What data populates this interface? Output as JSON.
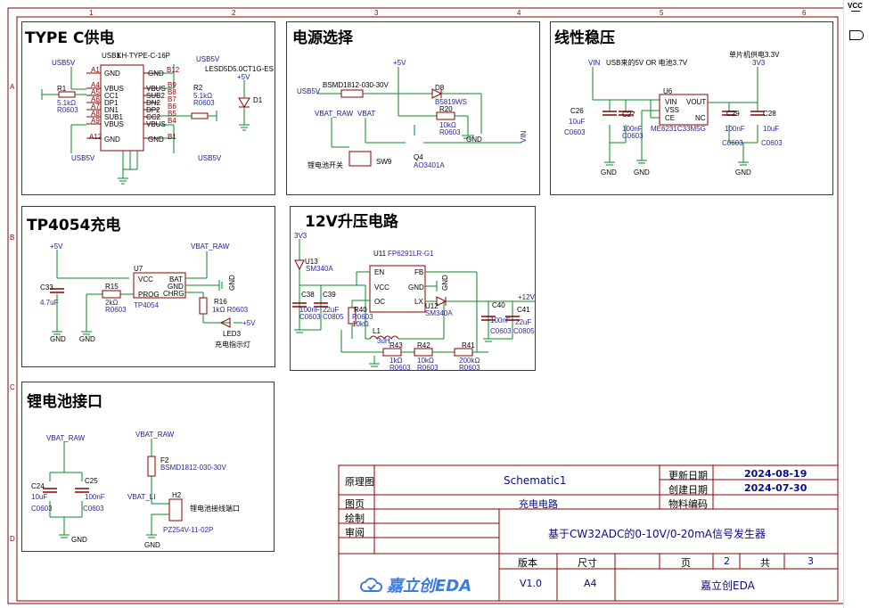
{
  "sections": {
    "typec": "TYPE C供电",
    "power_select": "电源选择",
    "ldo": "线性稳压",
    "charger": "TP4054充电",
    "boost": "12V升压电路",
    "battery": "锂电池接口"
  },
  "typec": {
    "usb_ref": "USB1",
    "usb_part": "KH-TYPE-C-16P",
    "net_usb5v_a": "USB5V",
    "net_usb5v_b": "USB5V",
    "net_usb5v_c": "USB5V",
    "net_usb5v_d": "USB5V",
    "pins_left": [
      "A1",
      "A4",
      "A5",
      "A6",
      "A7",
      "A8",
      "A9",
      "A12"
    ],
    "labels_left": [
      "GND",
      "VBUS",
      "CC1",
      "DP1",
      "DN1",
      "SUB1",
      "VBUS",
      "GND"
    ],
    "pins_right": [
      "B12",
      "B9",
      "B8",
      "B7",
      "B6",
      "B5",
      "B4",
      "B1"
    ],
    "labels_right": [
      "GND",
      "VBUS",
      "SUB2",
      "DN2",
      "DP2",
      "CC2",
      "VBUS",
      "GND"
    ],
    "r1_ref": "R1",
    "r1_val": "5.1kΩ",
    "r1_pkg": "R0603",
    "r2_ref": "R2",
    "r2_val": "5.1kΩ",
    "r2_pkg": "R0603",
    "d1_ref": "D1",
    "d1_part": "LESD5D5.0CT1G-ES",
    "net_5v": "+5V"
  },
  "power_select": {
    "net_5v": "+5V",
    "f_part": "BSMD1812-030-30V",
    "net_usb5v": "USB5V",
    "d8_ref": "D8",
    "d8_part": "B5819WS",
    "r20_ref": "R20",
    "r20_val": "10kΩ",
    "r20_pkg": "R0603",
    "net_vbat_raw": "VBAT_RAW",
    "net_vbat": "VBAT",
    "gnd": "GND",
    "q4_ref": "Q4",
    "q4_part": "AO3401A",
    "sw_ref": "SW9",
    "sw_label": "锂电池开关",
    "net_vin": "VIN"
  },
  "ldo": {
    "net_vin": "VIN",
    "note_in": "USB来的5V OR 电池3.7V",
    "note_out": "单片机供电3.3V",
    "net_3v3": "3V3",
    "u_ref": "U6",
    "u_part": "ME6231C33M5G",
    "pins": [
      "VIN",
      "VSS",
      "CE",
      "VOUT",
      "NC"
    ],
    "c26_ref": "C26",
    "c26_val": "10uF",
    "c26_pkg": "C0603",
    "c27_ref": "C27",
    "c27_val": "100nF",
    "c27_pkg": "C0603",
    "c29_ref": "C29",
    "c29_val": "100nF",
    "c29_pkg": "C0603",
    "c28_ref": "C28",
    "c28_val": "10uF",
    "c28_pkg": "C0603",
    "gnd": "GND"
  },
  "charger": {
    "net_5v": "+5V",
    "net_vbat_raw": "VBAT_RAW",
    "u_ref": "U7",
    "u_part": "TP4054",
    "pins": [
      "VCC",
      "PROG",
      "BAT",
      "GND",
      "CHRG"
    ],
    "c33_ref": "C33",
    "c33_val": "4.7uF",
    "r15_ref": "R15",
    "r15_val": "2kΩ",
    "r15_pkg": "R0603",
    "r16_ref": "R16",
    "r16_val": "1kΩ R0603",
    "led_ref": "LED3",
    "led_label": "充电指示灯",
    "gnd": "GND"
  },
  "boost": {
    "net_3v3": "3V3",
    "u13_ref": "U13",
    "u13_part": "SM340A",
    "u11_ref": "U11",
    "u11_part": "FP6291LR-G1",
    "pins": [
      "EN",
      "VCC",
      "OC",
      "FB",
      "GND",
      "LX"
    ],
    "c38_ref": "C38",
    "c38_val": "100nF",
    "c38_pkg": "C0603",
    "c39_ref": "C39",
    "c39_val": "22uF",
    "c39_pkg": "C0805",
    "r40_ref": "R40",
    "r40_pkg": "R0603",
    "r40_val": "10kΩ",
    "l1_ref": "L1",
    "l1_val": "3uH",
    "u12_ref": "U12",
    "u12_part": "SM340A",
    "r43_ref": "R43",
    "r43_val": "1kΩ",
    "r43_pkg": "R0603",
    "r42_ref": "R42",
    "r42_val": "10kΩ",
    "r42_pkg": "R0603",
    "r41_ref": "R41",
    "r41_val": "200kΩ",
    "r41_pkg": "R0603",
    "c40_ref": "C40",
    "c40_val": "100nF",
    "c40_pkg": "C0603",
    "c41_ref": "C41",
    "c41_val": "22uF",
    "c41_pkg": "C0805",
    "net_12v": "+12V",
    "gnd": "GND"
  },
  "battery": {
    "net_vbat_raw_a": "VBAT_RAW",
    "net_vbat_raw_b": "VBAT_RAW",
    "c24_ref": "C24",
    "c24_val": "10uF",
    "c24_pkg": "C0603",
    "c25_ref": "C25",
    "c25_val": "100nF",
    "c25_pkg": "C0603",
    "f2_ref": "F2",
    "f2_part": "BSMD1812-030-30V",
    "net_vbat_li": "VBAT_LI",
    "h2_ref": "H2",
    "h2_label": "锂电池接线端口",
    "h2_part": "PZ254V-11-02P",
    "gnd": "GND"
  },
  "title_block": {
    "schematic_label": "原理图",
    "schematic_value": "Schematic1",
    "page_label": "图页",
    "page_value": "充电电路",
    "draw_label": "绘制",
    "review_label": "审阅",
    "updated_label": "更新日期",
    "updated_value": "2024-08-19",
    "created_label": "创建日期",
    "created_value": "2024-07-30",
    "material_label": "物料编码",
    "project_title": "基于CW32ADC的0-10V/0-20mA信号发生器",
    "version_label": "版本",
    "version_value": "V1.0",
    "size_label": "尺寸",
    "size_value": "A4",
    "page_num_label": "页",
    "page_num_value": "2",
    "total_label": "共",
    "total_value": "3",
    "brand": "嘉立创EDA",
    "logo_text": "嘉立创EDA"
  },
  "side_panel": {
    "vcc_label": "VCC"
  },
  "frame_markers": {
    "rows": [
      "A",
      "B",
      "C",
      "D"
    ],
    "cols": [
      "1",
      "2",
      "3",
      "4",
      "5",
      "6"
    ]
  }
}
